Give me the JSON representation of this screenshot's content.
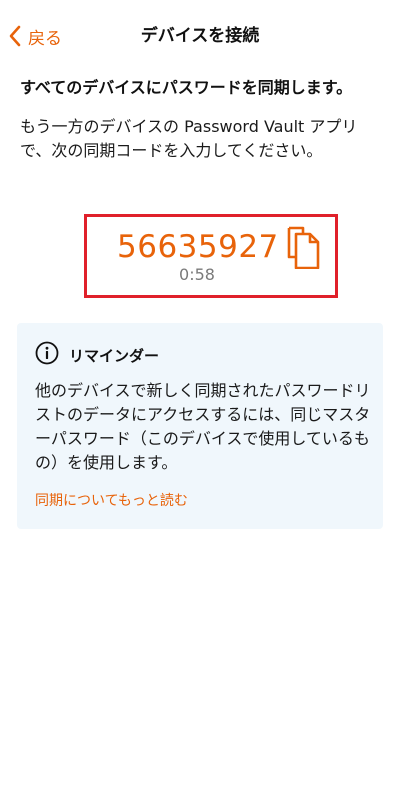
{
  "nav": {
    "back_label": "戻る",
    "title": "デバイスを接続"
  },
  "heading": "すべてのデバイスにパスワードを同期します。",
  "instruction": "もう一方のデバイスの Password Vault アプリで、次の同期コードを入力してください。",
  "sync": {
    "code": "56635927",
    "countdown": "0:58",
    "copy_icon": "copy-icon"
  },
  "reminder": {
    "icon": "info-icon",
    "title": "リマインダー",
    "body": "他のデバイスで新しく同期されたパスワードリストのデータにアクセスするには、同じマスターパスワード（このデバイスで使用しているもの）を使用します。",
    "link": "同期についてもっと読む"
  },
  "colors": {
    "accent": "#e8630a",
    "highlight_border": "#e0202a",
    "card_background": "#f0f7fc",
    "muted_text": "#7a7a7a"
  }
}
